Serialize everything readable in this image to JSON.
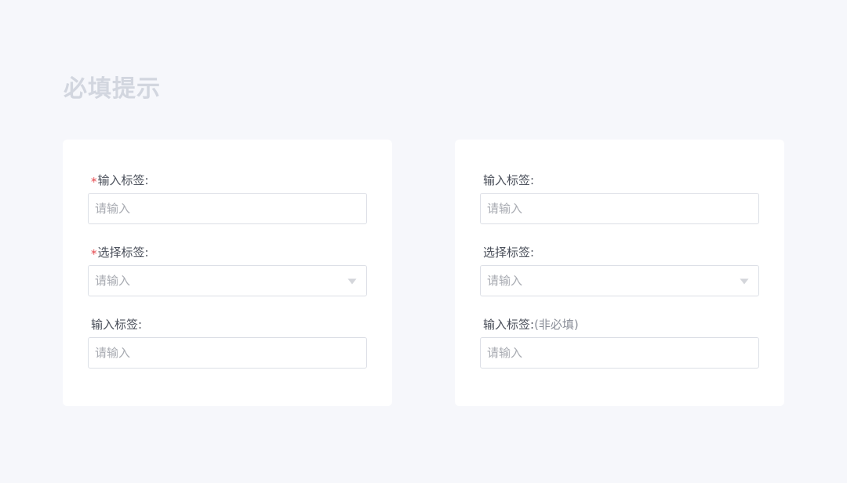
{
  "page": {
    "title": "必填提示"
  },
  "left_card": {
    "fields": [
      {
        "required_mark": "*",
        "label": "输入标签:",
        "placeholder": "请输入"
      },
      {
        "required_mark": "*",
        "label": "选择标签:",
        "placeholder": "请输入"
      },
      {
        "label": "输入标签:",
        "placeholder": "请输入"
      }
    ]
  },
  "right_card": {
    "fields": [
      {
        "label": "输入标签:",
        "placeholder": "请输入"
      },
      {
        "label": "选择标签:",
        "placeholder": "请输入"
      },
      {
        "label": "输入标签:",
        "optional_hint": "(非必填)",
        "placeholder": "请输入"
      }
    ]
  },
  "icons": {
    "select_caret": "caret-down-icon"
  },
  "colors": {
    "background": "#f6f7fb",
    "card": "#ffffff",
    "required": "#e5484d",
    "title": "#d2d6df",
    "border": "#dcdfe6",
    "placeholder": "#a8abb2"
  }
}
